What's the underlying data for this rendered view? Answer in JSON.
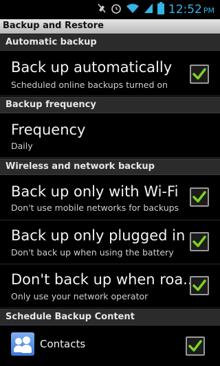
{
  "status_bar": {
    "time": "12:52",
    "ampm": "PM",
    "icons": [
      "mute-icon",
      "alarm-icon",
      "wifi-icon",
      "signal-icon",
      "battery-icon"
    ]
  },
  "title": "Backup and Restore",
  "sections": {
    "automatic": "Automatic backup",
    "frequency": "Backup frequency",
    "wireless": "Wireless and network backup",
    "schedule": "Schedule Backup Content"
  },
  "items": {
    "auto": {
      "title": "Back up automatically",
      "subtitle": "Scheduled online backups turned on",
      "checked": true
    },
    "frequency": {
      "title": "Frequency",
      "subtitle": "Daily"
    },
    "wifi": {
      "title": "Back up only with Wi-Fi",
      "subtitle": "Don't use mobile networks for backups",
      "checked": true
    },
    "plugged": {
      "title": "Back up only plugged in",
      "subtitle": "Don't back up when using the battery",
      "checked": true
    },
    "roaming": {
      "title": "Don't back up when roa..",
      "subtitle": "Only use your network operator",
      "checked": true
    },
    "contacts": {
      "title": "Contacts",
      "checked": true
    }
  },
  "colors": {
    "accent": "#33b5e5",
    "check": "#7ed321"
  }
}
